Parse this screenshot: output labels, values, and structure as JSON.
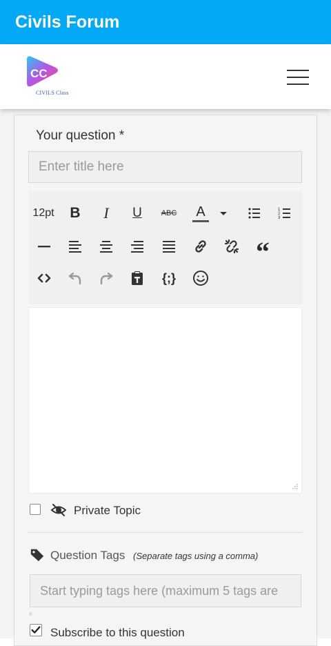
{
  "appbar": {
    "title": "Civils Forum"
  },
  "brand": {
    "logo_text": "CIVILS Class"
  },
  "form": {
    "question_label": "Your question *",
    "title_placeholder": "Enter title here",
    "toolbar": {
      "font_size": "12pt",
      "bold": "B",
      "italic": "I",
      "underline": "U",
      "strikethrough": "ABC",
      "font_color": "A",
      "code": "{;}",
      "quote": "“"
    },
    "private_label": "Private Topic",
    "private_checked": false,
    "tags_label": "Question Tags",
    "tags_hint": "(Separate tags using a comma)",
    "tags_placeholder": "Start typing tags here (maximum 5 tags are",
    "subscribe_label": "Subscribe to this question",
    "subscribe_checked": true
  },
  "colors": {
    "appbar": "#03a9f4",
    "accent": "#1565c0"
  }
}
